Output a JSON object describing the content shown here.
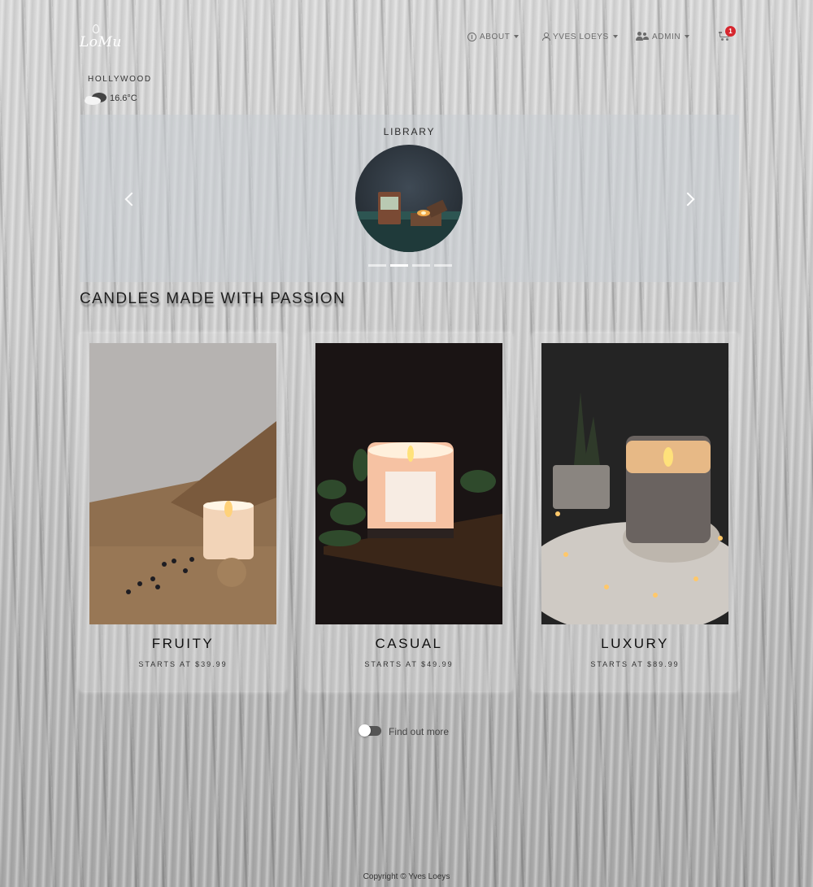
{
  "header": {
    "logo_text": "LoMu",
    "nav": [
      {
        "label": "ABOUT",
        "icon": "info-icon"
      },
      {
        "label": "YVES LOEYS",
        "icon": "user-icon"
      },
      {
        "label": "ADMIN",
        "icon": "users-icon"
      }
    ],
    "cart": {
      "icon": "cart-icon",
      "count": "1",
      "badge_color": "#d6262e"
    }
  },
  "weather": {
    "city": "HOLLYWOOD",
    "temperature": "16.6°C",
    "icon": "cloud-icon"
  },
  "carousel": {
    "title": "LIBRARY",
    "active_index": 1,
    "indicator_count": 4
  },
  "main": {
    "heading": "CANDLES MADE WITH PASSION"
  },
  "cards": [
    {
      "name": "FRUITY",
      "price": "STARTS AT $39.99"
    },
    {
      "name": "CASUAL",
      "price": "STARTS AT $49.99"
    },
    {
      "name": "LUXURY",
      "price": "STARTS AT $89.99"
    }
  ],
  "toggle": {
    "label": "Find out more",
    "on": false
  },
  "footer": {
    "copyright": "Copyright © Yves Loeys"
  }
}
